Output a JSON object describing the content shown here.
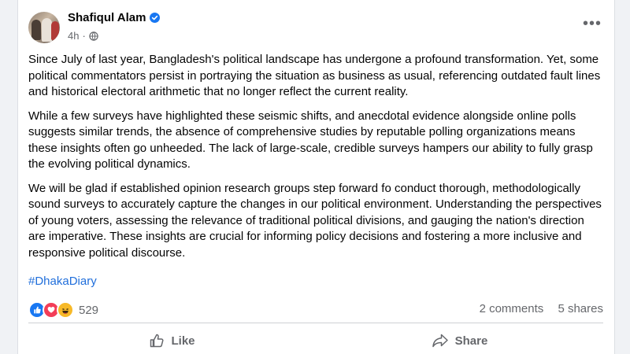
{
  "post": {
    "author": "Shafiqul Alam",
    "time": "4h",
    "separator": "·",
    "paragraphs": [
      "Since July of last year, Bangladesh's political landscape has undergone a profound transformation. Yet, some political commentators persist in portraying the situation as business as usual, referencing outdated fault lines and historical electoral arithmetic that no longer reflect the current reality.",
      "While a few surveys have highlighted these seismic shifts, and anecdotal evidence alongside online polls suggests similar trends, the absence of comprehensive studies by reputable polling organizations means these insights often go unheeded. The lack of large-scale, credible surveys hampers our ability to fully grasp the evolving political dynamics.",
      "We will be glad if established opinion research groups step forward fo conduct thorough, methodologically sound surveys to accurately capture the changes in our political environment. Understanding the perspectives of young voters, assessing the relevance of traditional political divisions, and gauging the nation's direction are imperative. These insights are crucial for informing policy decisions and fostering a more inclusive and responsive political discourse."
    ],
    "hashtag": "#DhakaDiary",
    "reaction_count": "529",
    "comments": "2 comments",
    "shares": "5 shares",
    "actions": {
      "like": "Like",
      "share": "Share"
    }
  },
  "icons": {
    "verified": "verified-badge-icon",
    "privacy": "globe-icon",
    "more": "more-options-icon",
    "reactions": [
      "like-reaction-icon",
      "love-reaction-icon",
      "haha-reaction-icon"
    ],
    "like": "thumbs-up-icon",
    "share": "share-arrow-icon"
  },
  "colors": {
    "link": "#216fdb",
    "secondary_text": "#65676b",
    "like_blue": "#1877f2",
    "love_red": "#f33e58",
    "haha_yellow": "#f7b928"
  }
}
